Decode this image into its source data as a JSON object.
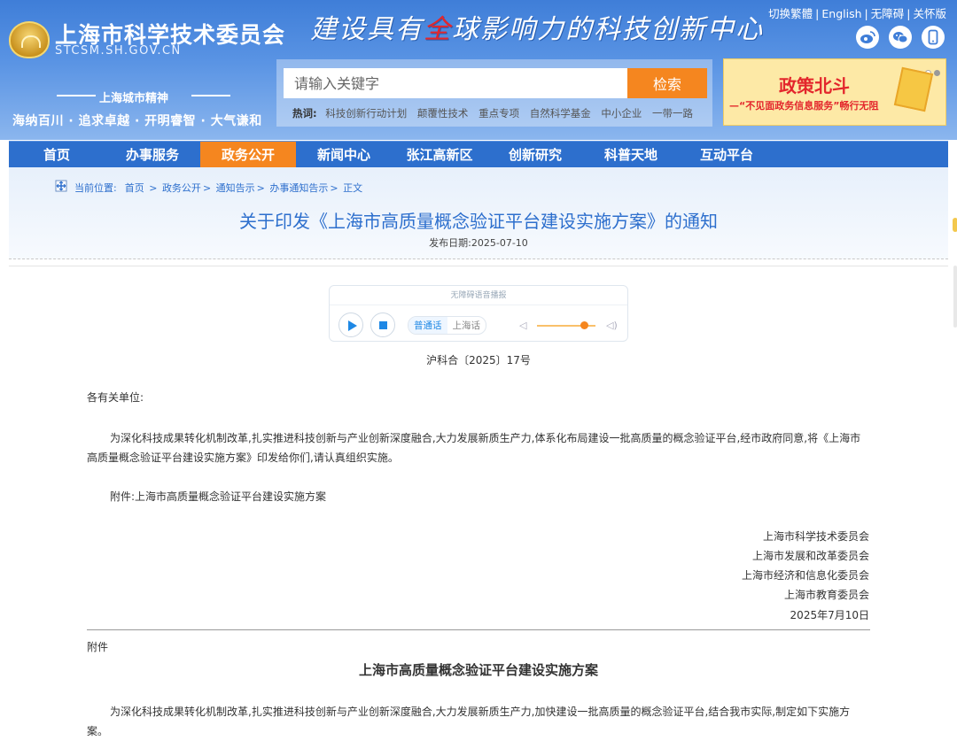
{
  "header": {
    "site_title": "上海市科学技术委员会",
    "site_domain": "STCSM.SH.GOV.CN",
    "slogan_part1": "建设具有",
    "slogan_red": "全",
    "slogan_part2": "球影响力的科技创新中心",
    "spirit_title": "上海城市精神",
    "spirit_text": "海纳百川 · 追求卓越 · 开明睿智 · 大气谦和",
    "top_links": [
      "切换繁體",
      "English",
      "无障碍",
      "关怀版"
    ],
    "social_icons": [
      "weibo-icon",
      "wechat-icon",
      "mobile-icon"
    ]
  },
  "search": {
    "placeholder": "请输入关键字",
    "button_label": "检索",
    "hot_label": "热词:",
    "hot_keywords": [
      "科技创新行动计划",
      "颠覆性技术",
      "重点专项",
      "自然科学基金",
      "中小企业",
      "一带一路"
    ]
  },
  "banner": {
    "title": "政策北斗",
    "subtitle": "—“不见面政务信息服务”畅行无阻"
  },
  "nav": {
    "items": [
      "首页",
      "办事服务",
      "政务公开",
      "新闻中心",
      "张江高新区",
      "创新研究",
      "科普天地",
      "互动平台"
    ],
    "active_index": 2
  },
  "breadcrumb": {
    "label": "当前位置:",
    "items": [
      "首页",
      ">",
      "政务公开",
      ">",
      "通知告示",
      ">",
      "办事通知告示",
      ">",
      "正文"
    ]
  },
  "article": {
    "title": "关于印发《上海市高质量概念验证平台建设实施方案》的通知",
    "publish_date": "发布日期:2025-07-10",
    "doc_number": "沪科合〔2025〕17号",
    "salutation": "各有关单位:",
    "paragraph1": "为深化科技成果转化机制改革,扎实推进科技创新与产业创新深度融合,大力发展新质生产力,体系化布局建设一批高质量的概念验证平台,经市政府同意,将《上海市高质量概念验证平台建设实施方案》印发给你们,请认真组织实施。",
    "attachment_line": "附件:上海市高质量概念验证平台建设实施方案",
    "signatures": [
      "上海市科学技术委员会",
      "上海市发展和改革委员会",
      "上海市经济和信息化委员会",
      "上海市教育委员会"
    ],
    "sign_date": "2025年7月10日",
    "annex_label": "附件",
    "annex_title": "上海市高质量概念验证平台建设实施方案",
    "annex_paragraph": "为深化科技成果转化机制改革,扎实推进科技创新与产业创新深度融合,大力发展新质生产力,加快建设一批高质量的概念验证平台,结合我市实际,制定如下实施方案。"
  },
  "player": {
    "header_text": "无障碍语音播报",
    "lang_options": [
      "普通话",
      "上海话"
    ],
    "active_lang": 0,
    "volume_level": 0.8
  },
  "colors": {
    "primary_blue": "#2d6fcd",
    "accent_orange": "#f5861f",
    "header_gradient_top": "#3f7ed8"
  }
}
